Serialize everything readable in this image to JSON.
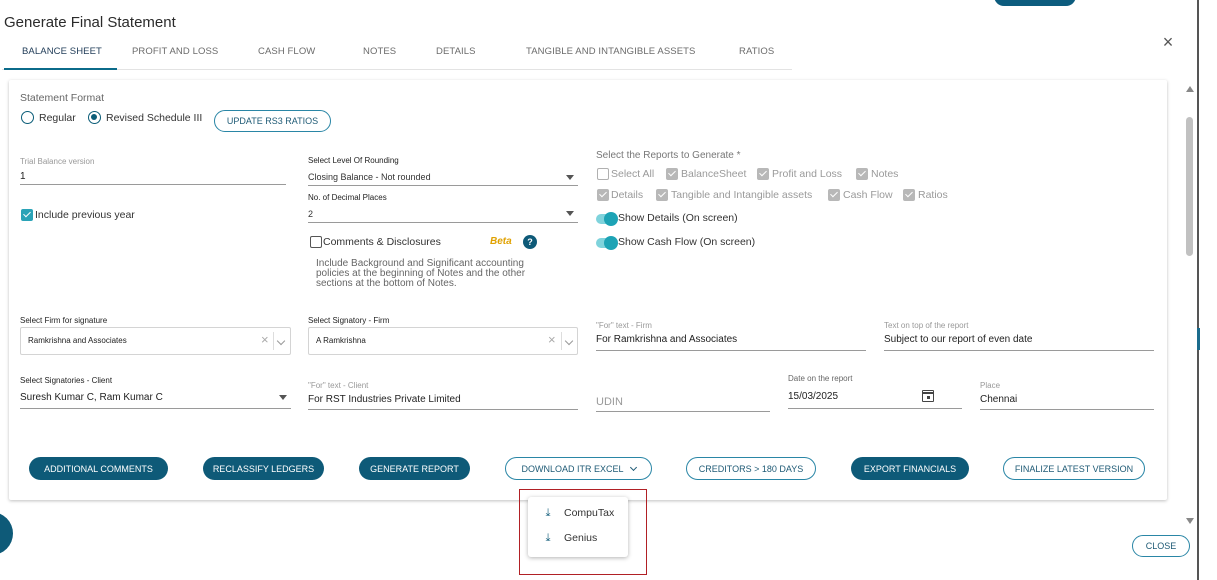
{
  "dialog": {
    "title": "Generate Final Statement",
    "close_symbol": "×"
  },
  "tabs": [
    {
      "label": "BALANCE SHEET",
      "active": true
    },
    {
      "label": "PROFIT AND LOSS"
    },
    {
      "label": "CASH FLOW"
    },
    {
      "label": "NOTES"
    },
    {
      "label": "DETAILS"
    },
    {
      "label": "TANGIBLE AND INTANGIBLE ASSETS"
    },
    {
      "label": "RATIOS"
    }
  ],
  "statement_format": {
    "label": "Statement Format",
    "options": [
      {
        "label": "Regular",
        "selected": false
      },
      {
        "label": "Revised Schedule III",
        "selected": true
      }
    ],
    "update_button": "UPDATE RS3 RATIOS"
  },
  "trial_balance": {
    "label": "Trial Balance version",
    "value": "1"
  },
  "include_prev_year": {
    "label": "Include previous year",
    "checked": true
  },
  "rounding": {
    "label": "Select Level Of Rounding",
    "value": "Closing Balance - Not rounded"
  },
  "decimals": {
    "label": "No. of Decimal Places",
    "value": "2"
  },
  "comments": {
    "label": "Comments & Disclosures",
    "beta": "Beta",
    "help_icon": "?",
    "description_lines": [
      "Include Background and Significant accounting",
      "policies at the beginning of Notes and the other",
      "sections at the bottom of Notes."
    ]
  },
  "reports": {
    "label": "Select the Reports to Generate *",
    "items": [
      {
        "label": "Select All",
        "checked": false
      },
      {
        "label": "BalanceSheet",
        "checked": true
      },
      {
        "label": "Profit and Loss",
        "checked": true
      },
      {
        "label": "Notes",
        "checked": true
      },
      {
        "label": "Details",
        "checked": true
      },
      {
        "label": "Tangible and Intangible assets",
        "checked": true
      },
      {
        "label": "Cash Flow",
        "checked": true
      },
      {
        "label": "Ratios",
        "checked": true
      }
    ],
    "show_details": "Show Details (On screen)",
    "show_cash_flow": "Show Cash Flow (On screen)"
  },
  "firm_signature": {
    "label": "Select Firm for signature",
    "value": "Ramkrishna and Associates"
  },
  "signatory_firm": {
    "label": "Select Signatory - Firm",
    "value": "A Ramkrishna"
  },
  "for_text_firm": {
    "label": "\"For\" text - Firm",
    "value": "For Ramkrishna and Associates"
  },
  "text_on_top": {
    "label": "Text on top of the report",
    "value": "Subject to our report of even date"
  },
  "signatories_client": {
    "label": "Select Signatories - Client",
    "value": "Suresh Kumar C, Ram Kumar C"
  },
  "for_text_client": {
    "label": "\"For\" text - Client",
    "value": "For RST Industries Private Limited"
  },
  "udin": {
    "placeholder": "UDIN"
  },
  "report_date": {
    "label": "Date on the report",
    "value": "15/03/2025"
  },
  "place": {
    "label": "Place",
    "value": "Chennai"
  },
  "actions": {
    "additional_comments": "ADDITIONAL COMMENTS",
    "reclassify": "RECLASSIFY LEDGERS",
    "generate": "GENERATE REPORT",
    "download_itr": "DOWNLOAD ITR EXCEL",
    "creditors": "CREDITORS > 180 DAYS",
    "export": "EXPORT FINANCIALS",
    "finalize": "FINALIZE LATEST VERSION"
  },
  "download_menu": [
    {
      "label": "CompuTax"
    },
    {
      "label": "Genius"
    }
  ],
  "footer": {
    "close": "CLOSE"
  },
  "colors": {
    "primary": "#0e5a78",
    "accent": "#2aa3b7",
    "highlight_border": "#b12025",
    "beta": "#e0a100"
  }
}
